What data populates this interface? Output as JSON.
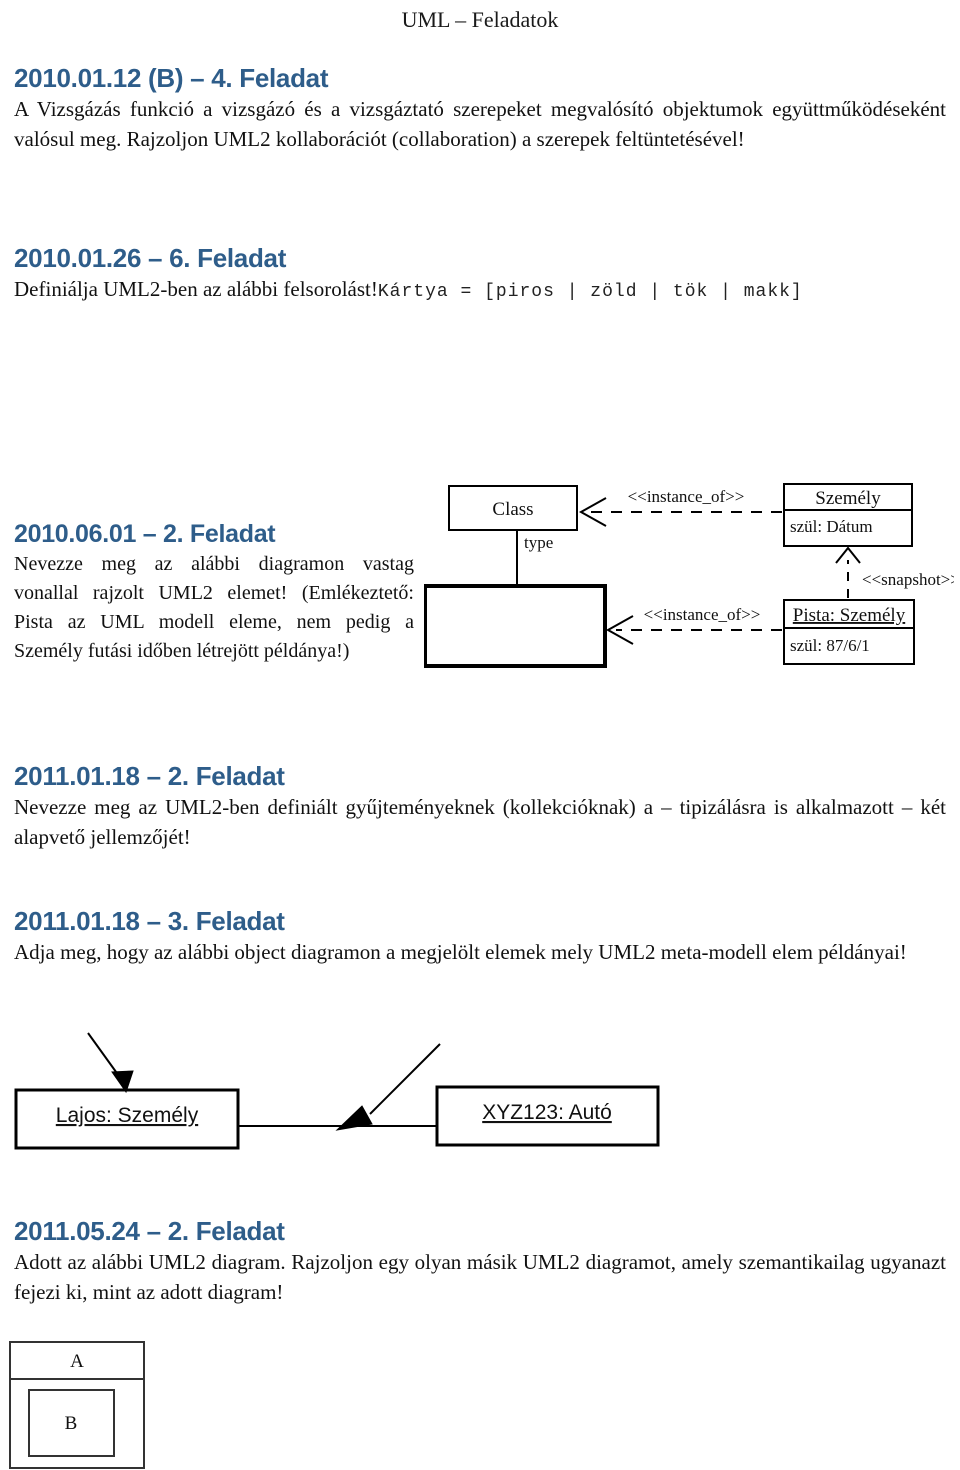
{
  "document": {
    "running_head": "UML – Feladatok"
  },
  "sections": [
    {
      "id": "2010-01-12",
      "heading": "2010.01.12 (B) – 4. Feladat",
      "body": "A Vizsgázás funkció a vizsgázó és a vizsgáztató szerepeket megvalósító objektumok együttműködéseként valósul meg. Rajzoljon UML2 kollaborációt (collaboration) a szerepek feltüntetésével!"
    },
    {
      "id": "2010-01-26",
      "heading": "2010.01.26 – 6. Feladat",
      "body": "Definiálja UML2-ben az alábbi felsorolást!",
      "code": "Kártya = [piros | zöld | tök | makk]"
    },
    {
      "id": "2010-06-01",
      "heading": "2010.06.01 – 2. Feladat",
      "body": "Nevezze meg az alábbi diagramon vastag vonallal rajzolt UML2 elemet! (Emlékeztető: Pista az UML modell eleme, nem pedig a Személy futási időben létrejött példánya!)"
    },
    {
      "id": "2011-01-18-2",
      "heading": "2011.01.18 – 2. Feladat",
      "body": "Nevezze meg az UML2-ben definiált gyűjteményeknek (kollekcióknak) a – tipizálásra is alkalmazott – két alapvető jellemzőjét!"
    },
    {
      "id": "2011-01-18-3",
      "heading": "2011.01.18 – 3. Feladat",
      "body": "Adja meg, hogy az alábbi object diagramon a megjelölt elemek mely UML2 meta-modell elem példányai!"
    },
    {
      "id": "2011-05-24",
      "heading": "2011.05.24 – 2. Feladat",
      "body": "Adott az alábbi UML2 diagram. Rajzoljon egy olyan másik UML2 diagramot, amely szemantikailag ugyanazt fejezi ki, mint az adott diagram!"
    }
  ],
  "diagrams": {
    "instance_of": {
      "class_box_label": "Class",
      "association_role_label": "type",
      "blank_box_label": "",
      "szemely_class_name": "Személy",
      "szemely_attribute": "szül: Dátum",
      "pista_object_name": "Pista: Személy",
      "pista_attribute": "szül: 87/6/1",
      "stereotype_instance_of_top": "<<instance_of>>",
      "stereotype_instance_of_bottom": "<<instance_of>>",
      "stereotype_snapshot": "<<snapshot>>"
    },
    "object_diagram": {
      "person_object": "Lajos: Személy",
      "car_object": "XYZ123: Autó"
    },
    "nested_ab": {
      "outer_label": "A",
      "inner_label": "B"
    }
  },
  "colors": {
    "heading_blue": "#2e5d8a",
    "text_black": "#111111",
    "line_black": "#000000",
    "page_background": "#ffffff"
  }
}
